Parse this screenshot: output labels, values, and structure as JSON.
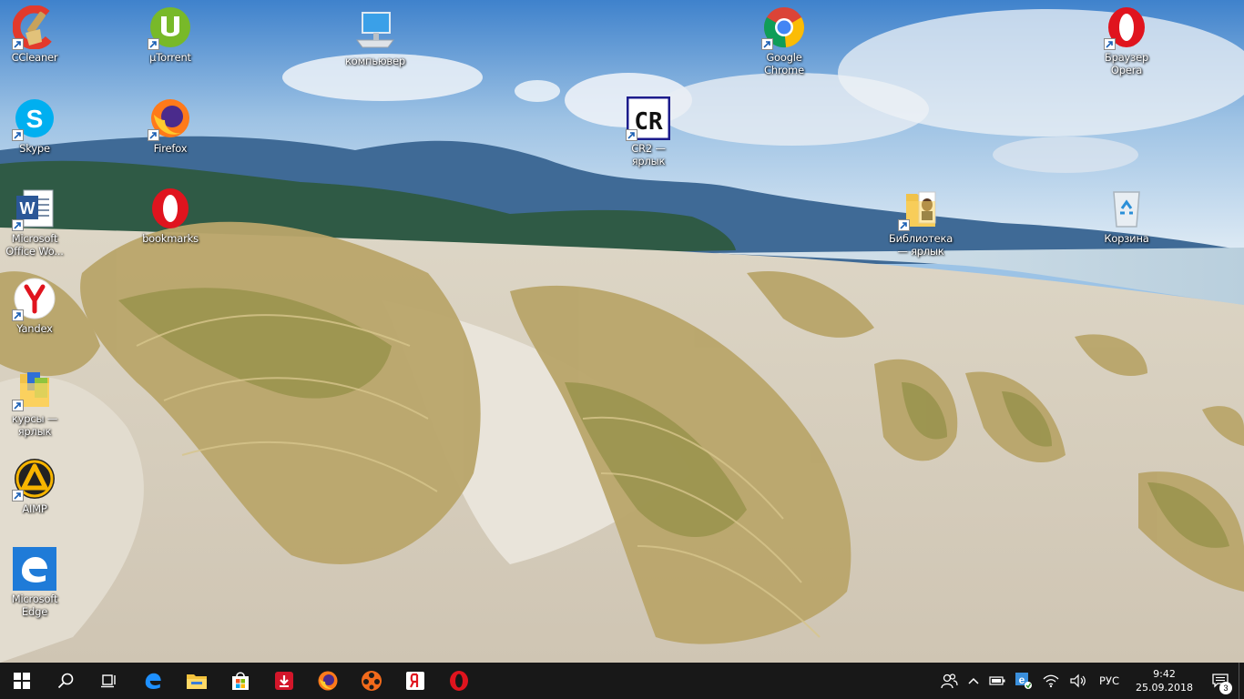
{
  "desktop": {
    "icons": [
      {
        "id": "ccleaner",
        "label": "CCleaner",
        "icon": "ccleaner-icon"
      },
      {
        "id": "utorrent",
        "label": "µTorrent",
        "icon": "utorrent-icon"
      },
      {
        "id": "computer",
        "label": "компьювер",
        "icon": "computer-icon"
      },
      {
        "id": "chrome",
        "label": "Google\nChrome",
        "icon": "chrome-icon"
      },
      {
        "id": "opera-browser",
        "label": "Браузер\nOpera",
        "icon": "opera-icon"
      },
      {
        "id": "skype",
        "label": "Skype",
        "icon": "skype-icon"
      },
      {
        "id": "firefox",
        "label": "Firefox",
        "icon": "firefox-icon"
      },
      {
        "id": "cr2",
        "label": "CR2 —\nярлык",
        "icon": "cr-icon"
      },
      {
        "id": "word",
        "label": "Microsoft\nOffice Wo...",
        "icon": "word-icon"
      },
      {
        "id": "bookmarks",
        "label": "bookmarks",
        "icon": "opera-icon"
      },
      {
        "id": "library",
        "label": "Библиотека\n— ярлык",
        "icon": "folder-icon"
      },
      {
        "id": "recycle",
        "label": "Корзина",
        "icon": "recycle-bin-icon"
      },
      {
        "id": "yandex",
        "label": "Yandex",
        "icon": "yandex-icon"
      },
      {
        "id": "courses",
        "label": "курсы —\nярлык",
        "icon": "folder-icon"
      },
      {
        "id": "aimp",
        "label": "AIMP",
        "icon": "aimp-icon"
      },
      {
        "id": "edge",
        "label": "Microsoft\nEdge",
        "icon": "edge-icon"
      }
    ]
  },
  "taskbar": {
    "buttons": [
      {
        "name": "start-button",
        "icon": "windows-logo-icon"
      },
      {
        "name": "search-button",
        "icon": "search-icon"
      },
      {
        "name": "task-view-button",
        "icon": "task-view-icon"
      }
    ],
    "pinned": [
      {
        "name": "taskbar-edge",
        "icon": "edge-icon"
      },
      {
        "name": "taskbar-explorer",
        "icon": "file-explorer-icon"
      },
      {
        "name": "taskbar-store",
        "icon": "store-icon"
      },
      {
        "name": "taskbar-downloader",
        "icon": "download-icon"
      },
      {
        "name": "taskbar-firefox",
        "icon": "firefox-icon"
      },
      {
        "name": "taskbar-media-player",
        "icon": "media-player-icon"
      },
      {
        "name": "taskbar-yandex",
        "icon": "yandex-icon"
      },
      {
        "name": "taskbar-opera",
        "icon": "opera-icon"
      }
    ],
    "tray": {
      "language": "РУС",
      "time": "9:42",
      "date": "25.09.2018",
      "notifications_count": "3"
    }
  },
  "colors": {
    "taskbar_bg": "#181818",
    "label_text": "#ffffff",
    "sky_top": "#4f8ed0",
    "sand": "#e6e0d4"
  }
}
